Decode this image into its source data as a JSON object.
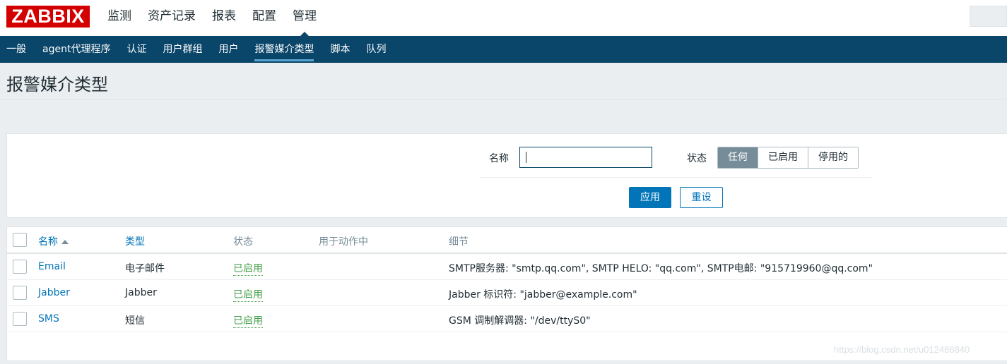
{
  "logo": "ZABBIX",
  "main_nav": [
    "监测",
    "资产记录",
    "报表",
    "配置",
    "管理"
  ],
  "sub_nav": [
    "一般",
    "agent代理程序",
    "认证",
    "用户群组",
    "用户",
    "报警媒介类型",
    "脚本",
    "队列"
  ],
  "page_title": "报警媒介类型",
  "filter": {
    "name_label": "名称",
    "name_value": "",
    "status_label": "状态",
    "status_options": [
      "任何",
      "已启用",
      "停用的"
    ],
    "status_selected": "任何",
    "apply_label": "应用",
    "reset_label": "重设"
  },
  "table": {
    "headers": [
      "名称",
      "类型",
      "状态",
      "用于动作中",
      "细节"
    ],
    "sort_column": "名称",
    "sort_direction": "asc",
    "rows": [
      {
        "name": "Email",
        "type": "电子邮件",
        "status": "已启用",
        "used_in_actions": "",
        "details": "SMTP服务器: \"smtp.qq.com\", SMTP HELO: \"qq.com\", SMTP电邮: \"915719960@qq.com\""
      },
      {
        "name": "Jabber",
        "type": "Jabber",
        "status": "已启用",
        "used_in_actions": "",
        "details": "Jabber 标识符: \"jabber@example.com\""
      },
      {
        "name": "SMS",
        "type": "短信",
        "status": "已启用",
        "used_in_actions": "",
        "details": "GSM 调制解调器: \"/dev/ttyS0\""
      }
    ]
  },
  "watermark": "https://blog.csdn.net/u012486840",
  "colors": {
    "brand_red": "#d40000",
    "nav_dark": "#0a466a",
    "link_blue": "#0275b8",
    "enabled_green": "#429e47",
    "segment_selected": "#768d99"
  }
}
